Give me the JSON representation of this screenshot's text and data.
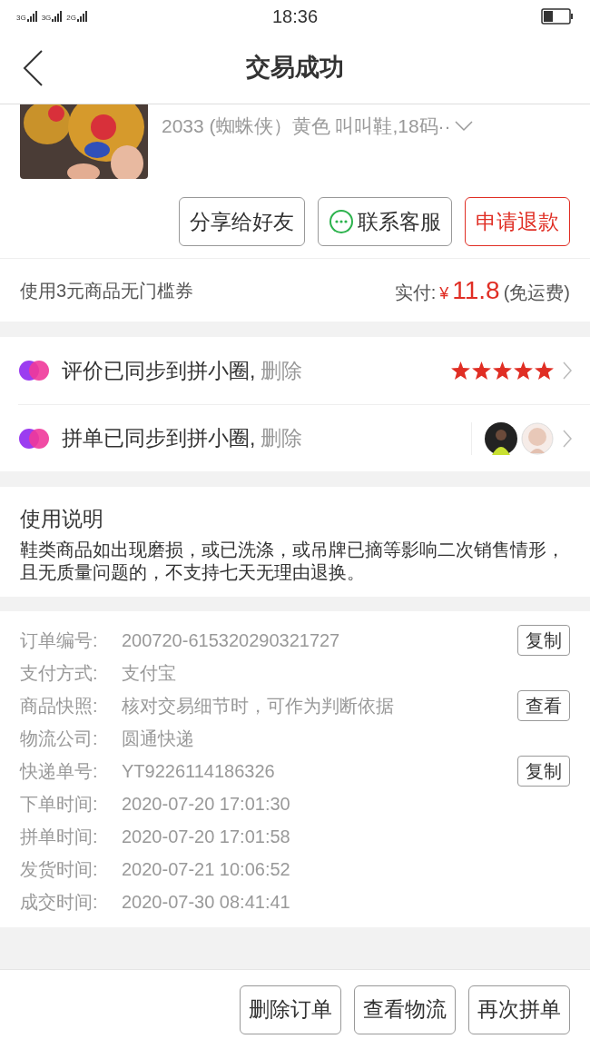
{
  "status_bar": {
    "network_1": "3G",
    "network_2": "3G",
    "network_3": "2G",
    "time": "18:36"
  },
  "header": {
    "title": "交易成功"
  },
  "product": {
    "spec": "2033 (蜘蛛侠）黄色 叫叫鞋,18码··"
  },
  "actions": [
    {
      "label": "分享给好友",
      "kind": "plain"
    },
    {
      "label": "联系客服",
      "kind": "chat"
    },
    {
      "label": "申请退款",
      "kind": "accent"
    }
  ],
  "payment": {
    "coupon": "使用3元商品无门槛券",
    "paid_label": "实付:",
    "currency": "¥",
    "amount": "11.8",
    "shipping": "(免运费)"
  },
  "sync_rows": [
    {
      "text": "评价已同步到拼小圈,",
      "action": "删除",
      "kind": "stars",
      "stars": 5
    },
    {
      "text": "拼单已同步到拼小圈,",
      "action": "删除",
      "kind": "avatars"
    }
  ],
  "notice": {
    "title": "使用说明",
    "body": "鞋类商品如出现磨损，或已洗涤，或吊牌已摘等影响二次销售情形，且无质量问题的，不支持七天无理由退换。"
  },
  "order_info": [
    {
      "label": "订单编号:",
      "value": "200720-615320290321727",
      "button": "复制"
    },
    {
      "label": "支付方式:",
      "value": "支付宝"
    },
    {
      "label": "商品快照:",
      "value": "核对交易细节时，可作为判断依据",
      "button": "查看"
    },
    {
      "label": "物流公司:",
      "value": "圆通快递"
    },
    {
      "label": "快递单号:",
      "value": "YT9226114186326",
      "button": "复制"
    },
    {
      "label": "下单时间:",
      "value": "2020-07-20 17:01:30"
    },
    {
      "label": "拼单时间:",
      "value": "2020-07-20 17:01:58"
    },
    {
      "label": "发货时间:",
      "value": "2020-07-21 10:06:52"
    },
    {
      "label": "成交时间:",
      "value": "2020-07-30 08:41:41"
    }
  ],
  "bottom_buttons": [
    "删除订单",
    "查看物流",
    "再次拼单"
  ]
}
